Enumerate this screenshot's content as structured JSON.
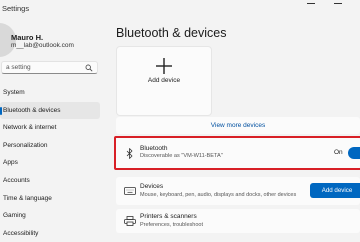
{
  "window": {
    "title": "Settings"
  },
  "user": {
    "name": "Mauro H.",
    "email": "m__lab@outlook.com"
  },
  "search": {
    "placeholder": "a setting"
  },
  "nav": {
    "items": [
      {
        "label": "System",
        "active": false
      },
      {
        "label": "Bluetooth & devices",
        "active": true
      },
      {
        "label": "Network & internet",
        "active": false
      },
      {
        "label": "Personalization",
        "active": false
      },
      {
        "label": "Apps",
        "active": false
      },
      {
        "label": "Accounts",
        "active": false
      },
      {
        "label": "Time & language",
        "active": false
      },
      {
        "label": "Gaming",
        "active": false
      },
      {
        "label": "Accessibility",
        "active": false
      }
    ]
  },
  "main": {
    "title": "Bluetooth & devices",
    "add_tile": {
      "label": "Add device",
      "icon": "plus-icon"
    },
    "more_link": "View more devices",
    "bluetooth": {
      "title": "Bluetooth",
      "subtitle": "Discoverable as \"VM-W11-BETA\"",
      "state": "On",
      "enabled": true,
      "icon": "bluetooth-icon"
    },
    "devices": {
      "title": "Devices",
      "subtitle": "Mouse, keyboard, pen, audio, displays and docks, other devices",
      "button": "Add device",
      "icon": "keyboard-icon"
    },
    "printers": {
      "title": "Printers & scanners",
      "subtitle": "Preferences, troubleshoot",
      "icon": "printer-icon"
    }
  },
  "colors": {
    "accent": "#0067c0",
    "highlight": "#d81f26",
    "background": "#f3f3f3",
    "card": "#fbfbfb"
  }
}
